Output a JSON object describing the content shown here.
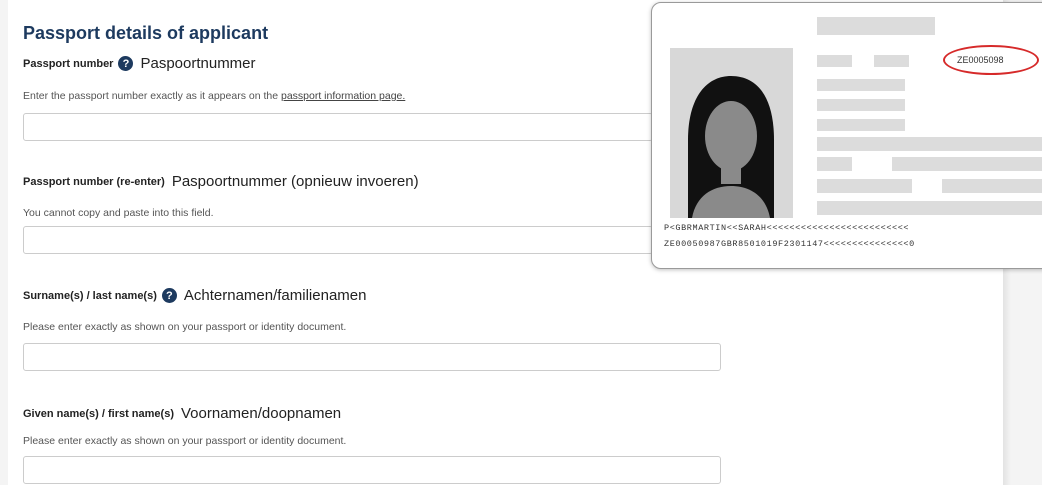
{
  "section": {
    "title": "Passport details of applicant"
  },
  "fields": [
    {
      "label": "Passport number",
      "translation": "Paspoortnummer",
      "hint_prefix": "Enter the passport number exactly as it appears on the ",
      "hint_link": "passport information page.",
      "value": ""
    },
    {
      "label": "Passport number (re-enter)",
      "translation": "Paspoortnummer (opnieuw invoeren)",
      "hint": "You cannot copy and paste into this field.",
      "value": ""
    },
    {
      "label": "Surname(s) / last name(s)",
      "translation": "Achternamen/familienamen",
      "hint": "Please enter exactly as shown on your passport or identity document.",
      "value": ""
    },
    {
      "label": "Given name(s) / first name(s)",
      "translation": "Voornamen/doopnamen",
      "hint": "Please enter exactly as shown on your passport or identity document.",
      "value": ""
    }
  ],
  "help_icon": {
    "glyph": "?",
    "icon": "question-circle-icon"
  },
  "passport_example": {
    "passport_number": "ZE0005098",
    "mrz_line1": "P<GBRMARTIN<<SARAH<<<<<<<<<<<<<<<<<<<<<<<<<",
    "mrz_line2": "ZE00050987GBR8501019F2301147<<<<<<<<<<<<<<<0",
    "highlight_color": "#d62a2a"
  }
}
